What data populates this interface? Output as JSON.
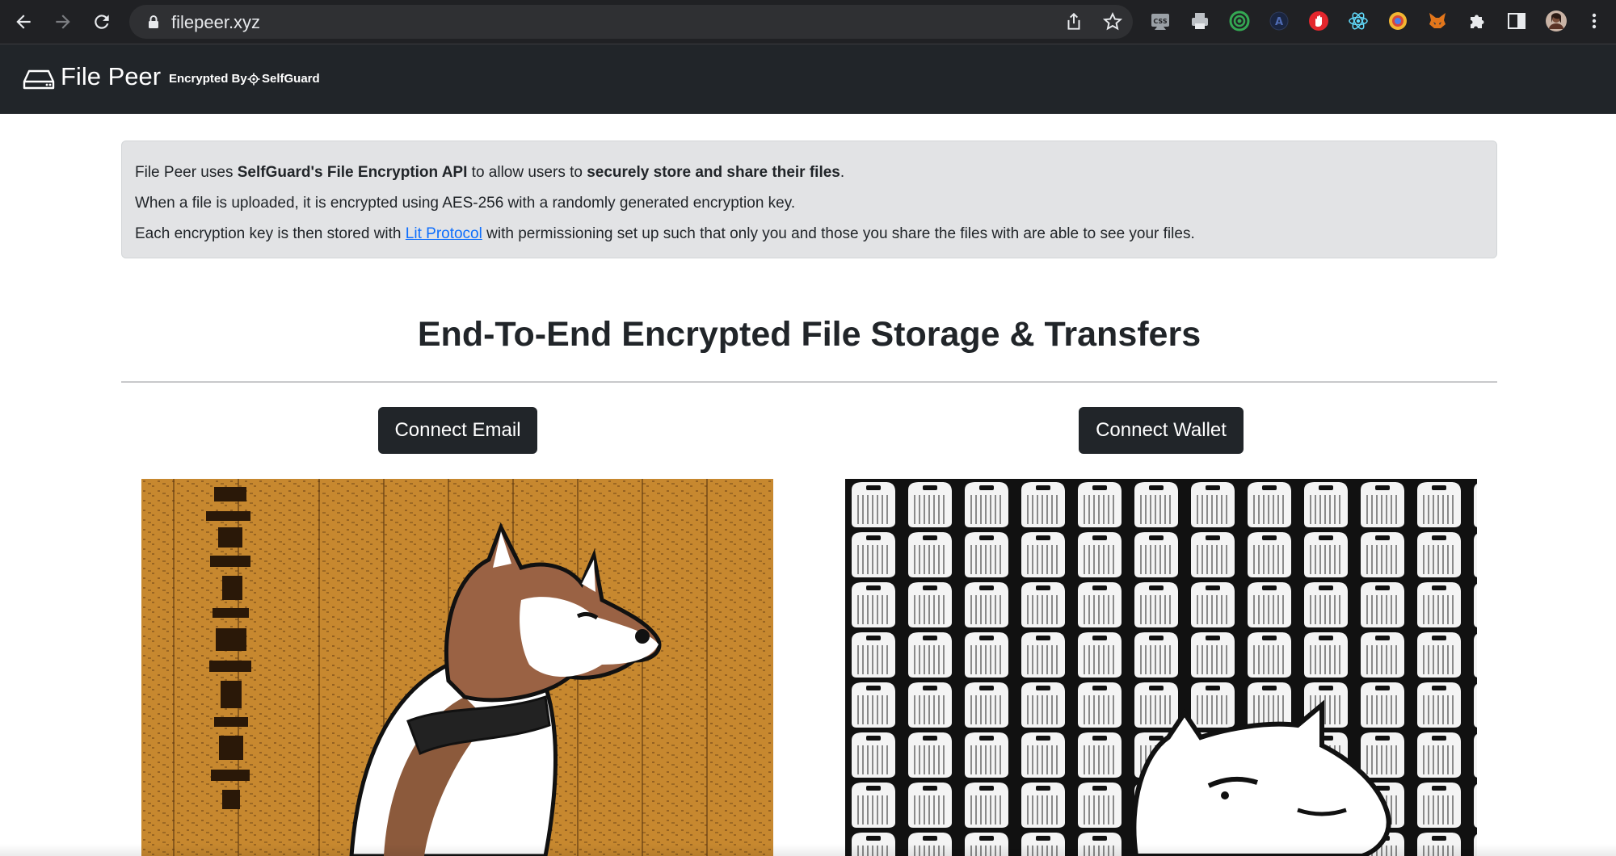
{
  "browser": {
    "url": "filepeer.xyz"
  },
  "site": {
    "brand": "File Peer",
    "encrypted_by": "Encrypted By",
    "partner": "SelfGuard"
  },
  "info": {
    "line1": {
      "pre": "File Peer uses ",
      "bold1": "SelfGuard's File Encryption API",
      "mid": " to allow users to ",
      "bold2": "securely store and share their files",
      "post": "."
    },
    "line2": "When a file is uploaded, it is encrypted using AES-256 with a randomly generated encryption key.",
    "line3": {
      "pre": "Each encryption key is then stored with ",
      "link": "Lit Protocol",
      "post": " with permissioning set up such that only you and those you share the files with are able to see your files."
    }
  },
  "main": {
    "heading": "End-To-End Encrypted File Storage & Transfers",
    "connect_email": "Connect Email",
    "connect_wallet": "Connect Wallet"
  },
  "colors": {
    "navbar": "#212529",
    "link": "#0d6efd",
    "alert_bg": "#e2e3e5"
  }
}
